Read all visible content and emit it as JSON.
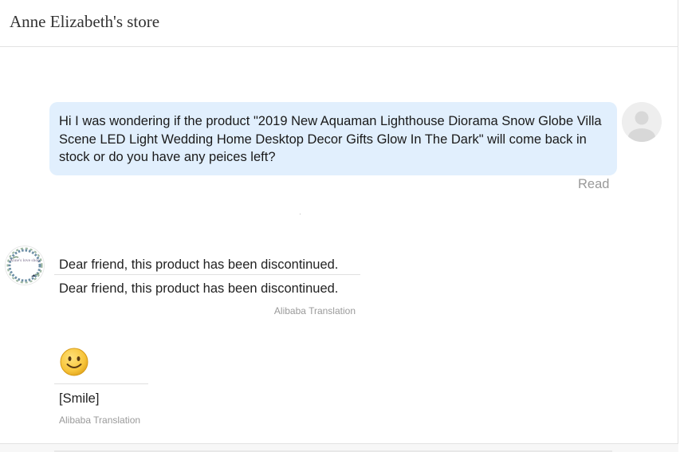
{
  "header": {
    "store_name": "Anne Elizabeth's store"
  },
  "conversation": {
    "outgoing_message": {
      "text": "Hi I was wondering if the product \"2019 New Aquaman Lighthouse Diorama Snow Globe Villa Scene LED Light Wedding Home Desktop Decor Gifts Glow In The Dark\" will come back in stock or do you have any peices left?",
      "status": "Read",
      "avatar_icon": "user-placeholder-icon"
    },
    "incoming_message": {
      "original": "Dear friend, this product has been discontinued.",
      "translated": "Dear friend, this product has been discontinued.",
      "translation_credit": "Alibaba Translation",
      "avatar_logo_text": "Anne's love shop"
    },
    "incoming_emoji_message": {
      "emoji_icon": "smile-emoji-icon",
      "translated": "[Smile]",
      "translation_credit": "Alibaba Translation"
    }
  },
  "colors": {
    "outgoing_bubble": "#e1effd",
    "muted_text": "#9a9a9a",
    "divider": "#e3e3e3",
    "emoji_yellow": "#f7c43a"
  }
}
